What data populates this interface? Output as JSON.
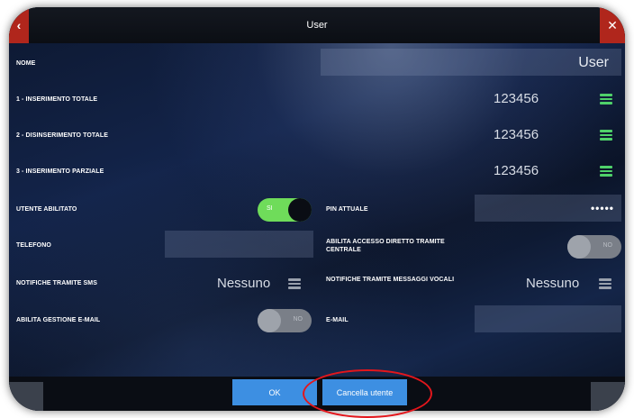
{
  "window": {
    "title": "User"
  },
  "form": {
    "nome": {
      "label": "NOME",
      "value": "User"
    },
    "inserimento_totale": {
      "label": "1 - INSERIMENTO TOTALE",
      "value": "123456"
    },
    "disinserimento_totale": {
      "label": "2 - DISINSERIMENTO TOTALE",
      "value": "123456"
    },
    "inserimento_parziale": {
      "label": "3 - INSERIMENTO PARZIALE",
      "value": "123456"
    },
    "utente_abilitato": {
      "label": "UTENTE ABILITATO",
      "toggle_text": "SI",
      "state": "on"
    },
    "pin_attuale": {
      "label": "PIN ATTUALE",
      "value": "•••••"
    },
    "telefono": {
      "label": "TELEFONO",
      "value": ""
    },
    "accesso_diretto": {
      "label": "ABILITA ACCESSO DIRETTO TRAMITE CENTRALE",
      "toggle_text": "NO",
      "state": "off"
    },
    "notifiche_sms": {
      "label": "NOTIFICHE TRAMITE SMS",
      "value": "Nessuno"
    },
    "notifiche_vocali": {
      "label": "NOTIFICHE TRAMITE MESSAGGI VOCALI",
      "value": "Nessuno"
    },
    "gestione_email": {
      "label": "ABILITA GESTIONE E-MAIL",
      "toggle_text": "NO",
      "state": "off"
    },
    "email": {
      "label": "E-MAIL",
      "value": ""
    }
  },
  "footer": {
    "ok_label": "OK",
    "cancel_user_label": "Cancella utente"
  },
  "colors": {
    "accent": "#3d8fe2",
    "toggle_on": "#6fdc5a",
    "menu_icon": "#4fd16a",
    "highlight_circle": "#e3161c",
    "corner": "#b0261c"
  },
  "icons": {
    "menu": "hamburger-icon",
    "close": "close-icon"
  }
}
